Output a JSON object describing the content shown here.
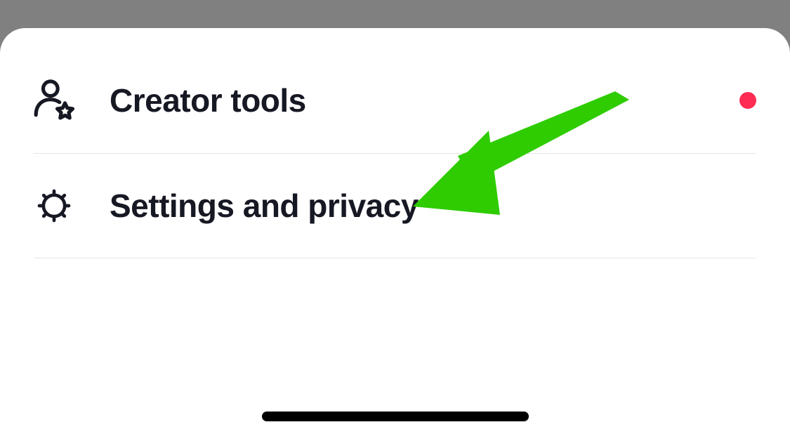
{
  "menu": {
    "items": [
      {
        "id": "creator-tools",
        "label": "Creator tools",
        "icon": "user-star-icon",
        "has_notification": true
      },
      {
        "id": "settings-privacy",
        "label": "Settings and privacy",
        "icon": "gear-icon",
        "has_notification": false
      }
    ]
  },
  "colors": {
    "notification_dot": "#fe2c55",
    "annotation_arrow": "#2ecc00"
  }
}
